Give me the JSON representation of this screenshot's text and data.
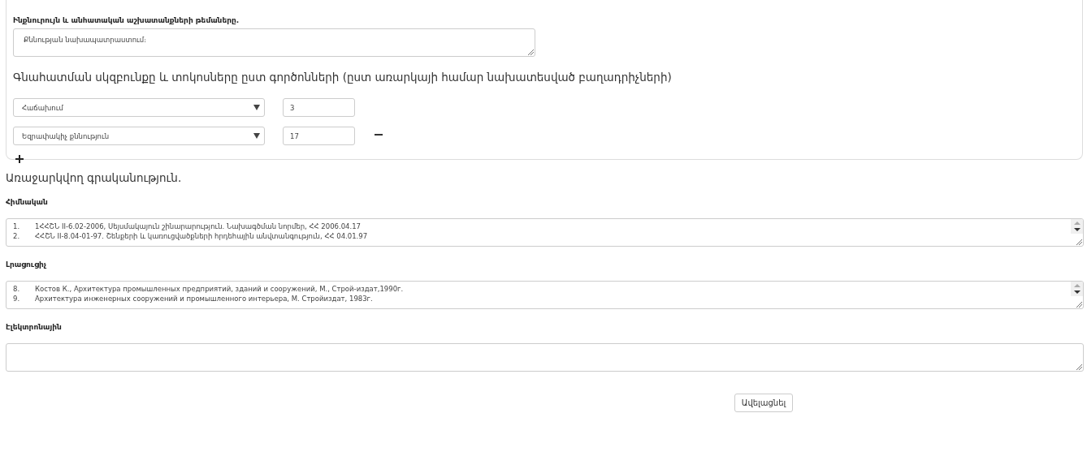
{
  "topics": {
    "label": "Ինքնուրույն և անհատական աշխատանքների թեմաները.",
    "value": "Քննության նախապատրաստում։"
  },
  "grading": {
    "title": "Գնահատման սկզբունքը և տոկոսները ըստ գործոնների (ըստ առարկայի համար նախատեսված բաղադրիչների)",
    "rows": [
      {
        "factor": "Հաճախում",
        "percent": "3",
        "removable": false
      },
      {
        "factor": "Եզրափակիչ քննություն",
        "percent": "17",
        "removable": true
      }
    ]
  },
  "literature": {
    "title": "Առաջարկվող գրականություն.",
    "sections": [
      {
        "label": "Հիմնական",
        "scroll": true,
        "lines": [
          {
            "number": "1.",
            "text": "1ՀՀՇՆ II-6.02-2006, Սեյսմակայուն շինարարություն. Նախագծման նորմեր, ՀՀ 2006.04.17"
          },
          {
            "number": "2.",
            "text": "ՀՀՇՆ  II-8.04-01-97. Շենքերի և կառուցվածքների հրդեհային անվտանգություն, ՀՀ 04.01.97"
          }
        ]
      },
      {
        "label": "Լրացուցիչ",
        "scroll": true,
        "lines": [
          {
            "number": "8.",
            "text": "Костов К., Архитектура промышленных предприятий, зданий и сооружений, М., Строй-издат,1990г."
          },
          {
            "number": "9.",
            "text": "Архитектура инженерных сооружений и промышленного интерьера, М. Стройиздат, 1983г."
          }
        ]
      },
      {
        "label": "Էլեկտրոնային",
        "scroll": false
      }
    ]
  },
  "buttons": [
    {
      "label": "Ավելացնել"
    }
  ]
}
